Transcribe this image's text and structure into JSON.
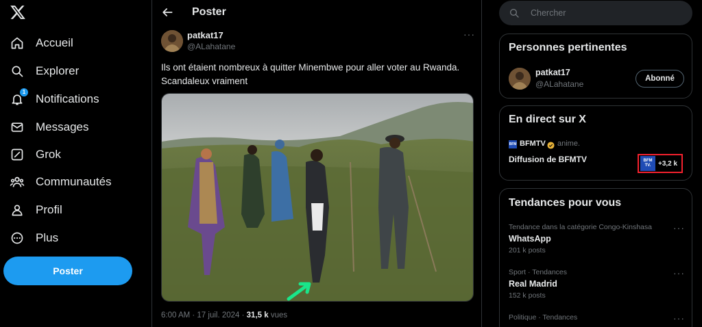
{
  "nav": {
    "items": [
      {
        "label": "Accueil",
        "icon": "home-icon"
      },
      {
        "label": "Explorer",
        "icon": "search-icon"
      },
      {
        "label": "Notifications",
        "icon": "bell-icon",
        "badge": "1"
      },
      {
        "label": "Messages",
        "icon": "envelope-icon"
      },
      {
        "label": "Grok",
        "icon": "grok-icon"
      },
      {
        "label": "Communautés",
        "icon": "communities-icon"
      },
      {
        "label": "Profil",
        "icon": "person-icon"
      },
      {
        "label": "Plus",
        "icon": "more-circle-icon"
      }
    ],
    "post_button": "Poster"
  },
  "header": {
    "title": "Poster"
  },
  "tweet": {
    "author_name": "patkat17",
    "author_handle": "@ALahatane",
    "text": "Ils ont étaient nombreux à quitter Minembwe pour aller voter au Rwanda. Scandaleux vraiment",
    "time": "6:00 AM · 17 juil. 2024 · ",
    "views_count": "31,5 k",
    "views_label": " vues"
  },
  "search": {
    "placeholder": "Chercher"
  },
  "relevant_people": {
    "title": "Personnes pertinentes",
    "name": "patkat17",
    "handle": "@ALahatane",
    "button": "Abonné"
  },
  "live": {
    "title": "En direct sur X",
    "channel": "BFMTV",
    "status": "anime.",
    "broadcast": "Diffusion de BFMTV",
    "thumb_text": "BFM TV.",
    "viewers": "+3,2 k"
  },
  "trends": {
    "title": "Tendances pour vous",
    "items": [
      {
        "context": "Tendance dans la catégorie Congo-Kinshasa",
        "name": "WhatsApp",
        "count": "201 k posts"
      },
      {
        "context": "Sport · Tendances",
        "name": "Real Madrid",
        "count": "152 k posts"
      },
      {
        "context": "Politique · Tendances",
        "name": "",
        "count": ""
      }
    ]
  },
  "colors": {
    "accent": "#1d9bf0",
    "background": "#000000",
    "border": "#2f3336",
    "live_border": "#f4212e"
  }
}
